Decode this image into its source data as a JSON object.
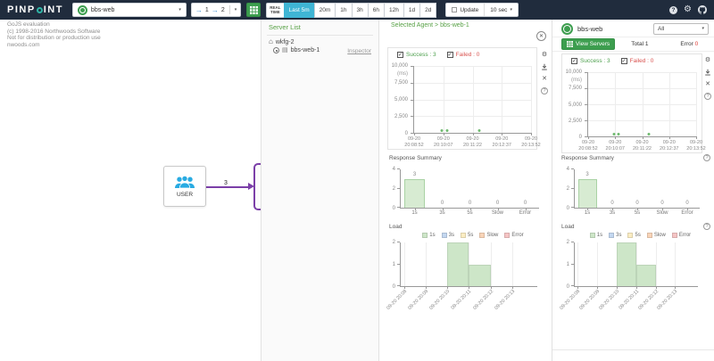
{
  "topbar": {
    "logo_part1": "PINP",
    "logo_part2": "INT",
    "app_selector_value": "bbs-web",
    "depth_in": "1",
    "depth_out": "2",
    "realtime_line1": "REAL",
    "realtime_line2": "TIME",
    "time_ranges": [
      "Last 5m",
      "20m",
      "1h",
      "3h",
      "6h",
      "12h",
      "1d",
      "2d"
    ],
    "selected_range": "Last 5m",
    "update_label": "Update",
    "interval_value": "10 sec"
  },
  "watermark": {
    "line1": "GoJS evaluation",
    "line2": "(c) 1998-2016 Northwoods Software",
    "line3": "Not for distribution or production use",
    "line4": "nwoods.com"
  },
  "map": {
    "user_node_label": "USER",
    "edge_count": "3"
  },
  "server_list": {
    "title": "Server List",
    "host_name": "wkfg-2",
    "agent_name": "bbs-web-1",
    "inspector_link": "Inspector"
  },
  "agent_panel": {
    "title": "Selected Agent > bbs-web-1",
    "success_label": "Success : 3",
    "failed_label": "Failed : 0",
    "response_summary_title": "Response Summary",
    "load_title": "Load"
  },
  "app_panel": {
    "app_name": "bbs-web",
    "scope_value": "All",
    "view_servers_label": "View Servers",
    "total_label": "Total",
    "total_value": "1",
    "error_label": "Error",
    "error_value": "0",
    "success_label": "Success : 3",
    "failed_label": "Failed : 0",
    "response_summary_title": "Response Summary",
    "load_title": "Load"
  },
  "icons": {
    "home": "⌂",
    "server": "▤",
    "gear": "⚙",
    "close": "✕",
    "help": "?",
    "check": "✓",
    "caret": "▾",
    "arrow": "→"
  },
  "colors": {
    "topbar_bg": "#202c3d",
    "accent_green": "#3d9e4f",
    "accent_cyan": "#3fb5d4",
    "title_green": "#58a146",
    "success_green": "#4a9e4a",
    "fail_red": "#d9534f",
    "edge_purple": "#7b3fa8",
    "user_icon_blue": "#29abe2"
  },
  "chart_data": [
    {
      "id": "response_time",
      "type": "scatter",
      "title": "Response time scatter",
      "ylabel": "(ms)",
      "ylim": [
        0,
        10000
      ],
      "yticks": [
        "10,000",
        "7,500",
        "5,000",
        "2,500",
        "0"
      ],
      "xticks": [
        [
          "09-20",
          "20:08:52"
        ],
        [
          "09-20",
          "20:10:07"
        ],
        [
          "09-20",
          "20:11:22"
        ],
        [
          "09-20",
          "20:12:37"
        ],
        [
          "09-20",
          "20:13:52"
        ]
      ],
      "grid": true,
      "point_color": "#6fba6f",
      "points": [
        {
          "x": 0.24,
          "y": 150
        },
        {
          "x": 0.28,
          "y": 150
        },
        {
          "x": 0.56,
          "y": 150
        }
      ]
    },
    {
      "id": "response_summary",
      "type": "bar",
      "title": "Response Summary",
      "categories": [
        "1s",
        "3s",
        "5s",
        "Slow",
        "Error"
      ],
      "values": [
        3,
        0,
        0,
        0,
        0
      ],
      "ylim": [
        0,
        4
      ],
      "yticks": [
        0,
        2,
        4
      ],
      "bar_color": "#d7ebd2",
      "bar_border": "#a9d2a4"
    },
    {
      "id": "load",
      "type": "bar",
      "stacked": true,
      "title": "Load",
      "categories": [
        "09-20 20:08",
        "09-20 20:09",
        "09-20 20:10",
        "09-20 20:11",
        "09-20 20:12",
        "09-20 20:13"
      ],
      "series": [
        {
          "name": "1s",
          "color": "#cde6c8",
          "values": [
            0,
            0,
            2,
            1,
            0,
            0
          ]
        },
        {
          "name": "3s",
          "color": "#c3d7f0",
          "values": [
            0,
            0,
            0,
            0,
            0,
            0
          ]
        },
        {
          "name": "5s",
          "color": "#fbedc3",
          "values": [
            0,
            0,
            0,
            0,
            0,
            0
          ]
        },
        {
          "name": "Slow",
          "color": "#f9d4b8",
          "values": [
            0,
            0,
            0,
            0,
            0,
            0
          ]
        },
        {
          "name": "Error",
          "color": "#f5c4c4",
          "values": [
            0,
            0,
            0,
            0,
            0,
            0
          ]
        }
      ],
      "ylim": [
        0,
        2
      ],
      "yticks": [
        0,
        1,
        2
      ],
      "legend_position": "top"
    }
  ]
}
